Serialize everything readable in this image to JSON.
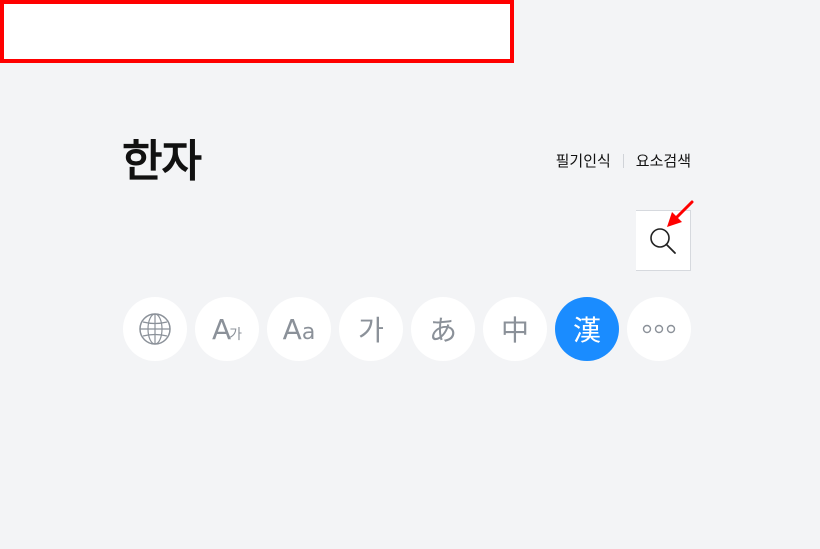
{
  "header": {
    "title": "한자",
    "links": [
      "필기인식",
      "요소검색"
    ]
  },
  "search": {
    "value": "",
    "placeholder": ""
  },
  "languages": [
    {
      "name": "globe-icon",
      "label": ""
    },
    {
      "name": "A가",
      "label_main": "A",
      "label_sub": "가"
    },
    {
      "name": "Aa",
      "label_main": "A",
      "label_sub": "a"
    },
    {
      "name": "가",
      "label": "가"
    },
    {
      "name": "あ",
      "label": "あ"
    },
    {
      "name": "中",
      "label": "中"
    },
    {
      "name": "漢",
      "label": "漢"
    },
    {
      "name": "more-icon",
      "label": ""
    }
  ],
  "colors": {
    "background": "#f3f4f6",
    "accent": "#1a8cff",
    "highlight_box": "#ff0000",
    "arrow": "#ff0000"
  },
  "active_language": "漢"
}
